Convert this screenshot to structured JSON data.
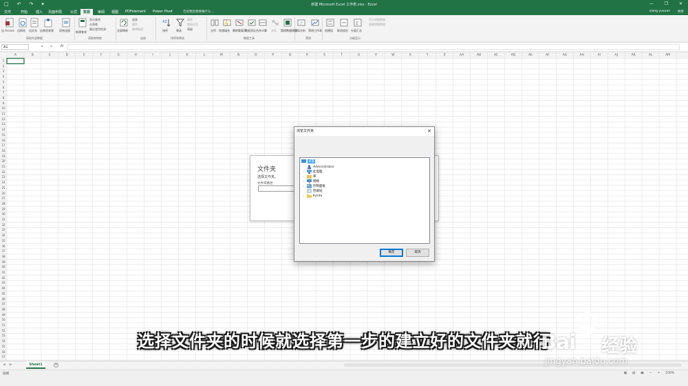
{
  "titlebar": {
    "title": "新建 Microsoft Excel 工作表.xlsx - Excel",
    "qat": [
      "□",
      "↶",
      "↷",
      "▾"
    ],
    "winctl": [
      "—",
      "❐",
      "✕"
    ]
  },
  "tabs": [
    "文件",
    "开始",
    "插入",
    "页面布局",
    "公式",
    "数据",
    "审阅",
    "视图",
    "PDFelement",
    "Power Pivot"
  ],
  "active_tab_index": 5,
  "tellme": "告诉我您想要做什么...",
  "user": "xiang yuxuan",
  "share": "共享",
  "ribbon": {
    "buttons": [
      {
        "label": "自 Access",
        "icon": "access-icon"
      },
      {
        "label": "自网站",
        "icon": "web-icon"
      },
      {
        "label": "自文本",
        "icon": "text-icon"
      },
      {
        "label": "自其他来源",
        "icon": "other-source-icon"
      },
      {
        "label": "现有连接",
        "icon": "connection-icon"
      },
      {
        "label": "新建查询",
        "icon": "new-query-icon"
      },
      {
        "label": "全部刷新",
        "icon": "refresh-icon"
      },
      {
        "label": "排序",
        "icon": "sort-icon"
      },
      {
        "label": "筛选",
        "icon": "filter-icon"
      },
      {
        "label": "分列",
        "icon": "split-icon"
      },
      {
        "label": "快速填充",
        "icon": "flash-fill-icon"
      },
      {
        "label": "删除重复项",
        "icon": "remove-dup-icon"
      },
      {
        "label": "数据验证",
        "icon": "validate-icon"
      },
      {
        "label": "合并计算",
        "icon": "consolidate-icon"
      },
      {
        "label": "关系",
        "icon": "relation-icon"
      },
      {
        "label": "管理数据模型",
        "icon": "model-icon"
      },
      {
        "label": "模拟分析",
        "icon": "whatif-icon"
      },
      {
        "label": "预测工作表",
        "icon": "forecast-icon"
      },
      {
        "label": "创建组",
        "icon": "group-icon"
      },
      {
        "label": "取消组合",
        "icon": "ungroup-icon"
      },
      {
        "label": "分类汇总",
        "icon": "subtotal-icon"
      }
    ],
    "small": {
      "query": [
        "显示查询",
        "从表格",
        "最近使用的源"
      ],
      "connections": [
        "连接",
        "属性",
        "编辑链接"
      ],
      "filter": [
        "清除",
        "重新应用",
        "高级"
      ],
      "outline": [
        "显示明细数据",
        "隐藏明细数据"
      ]
    },
    "groups": [
      "获取外部数据",
      "获取和转换",
      "连接",
      "排序和筛选",
      "数据工具",
      "预测",
      "分级显示"
    ]
  },
  "formulabar": {
    "namebox": "A1",
    "fx": "fx",
    "icons": [
      "▾",
      "✕",
      "✓"
    ]
  },
  "grid": {
    "columns": [
      "A",
      "B",
      "C",
      "D",
      "E",
      "F",
      "G",
      "H",
      "I",
      "J",
      "K",
      "L",
      "M",
      "N",
      "O",
      "P",
      "Q",
      "R",
      "S",
      "T",
      "U",
      "V",
      "W",
      "X",
      "Y",
      "Z",
      "AA",
      "AB",
      "AC",
      "AD",
      "AE",
      "AF",
      "AG",
      "AH",
      "AI",
      "AJ",
      "AK",
      "AL",
      "AM"
    ],
    "row_count": 57
  },
  "sheetbar": {
    "sheet_name": "Sheet1",
    "add_sheet": "+",
    "nav": [
      "◀",
      "▶"
    ]
  },
  "statusbar": {
    "ready": "就绪",
    "right": [
      "▦",
      "▤",
      "▣",
      "−",
      "+",
      "100%"
    ]
  },
  "background_panel": {
    "title": "文件夹",
    "subtitle": "选择文件夹。",
    "label": "文件夹路径"
  },
  "dialog": {
    "title": "浏览文件夹",
    "close": "✕",
    "tree": [
      {
        "label": "桌面",
        "level": 0,
        "selected": true,
        "icon": "desktop-icon",
        "expander": ""
      },
      {
        "label": "Administrator",
        "level": 1,
        "selected": false,
        "icon": "user-icon",
        "expander": ""
      },
      {
        "label": "此电脑",
        "level": 1,
        "selected": false,
        "icon": "pc-icon",
        "expander": "›"
      },
      {
        "label": "库",
        "level": 1,
        "selected": false,
        "icon": "library-icon",
        "expander": "›"
      },
      {
        "label": "网络",
        "level": 1,
        "selected": false,
        "icon": "network-icon",
        "expander": "›"
      },
      {
        "label": "控制面板",
        "level": 1,
        "selected": false,
        "icon": "control-panel-icon",
        "expander": "›"
      },
      {
        "label": "回收站",
        "level": 1,
        "selected": false,
        "icon": "recycle-bin-icon",
        "expander": ""
      },
      {
        "label": "Karita",
        "level": 1,
        "selected": false,
        "icon": "folder-icon",
        "expander": "›"
      }
    ],
    "ok_label": "确定",
    "cancel_label": "取消"
  },
  "caption": "选择文件夹的时候就选择第一步的建立好的文件夹就行",
  "watermark": {
    "brand": "Bai",
    "brand_cn": "经验",
    "url": "jingyan.baidu.com"
  },
  "colors": {
    "excel_green": "#217346",
    "selection_blue": "#3399ff",
    "caption_fill": "#ffffff"
  }
}
